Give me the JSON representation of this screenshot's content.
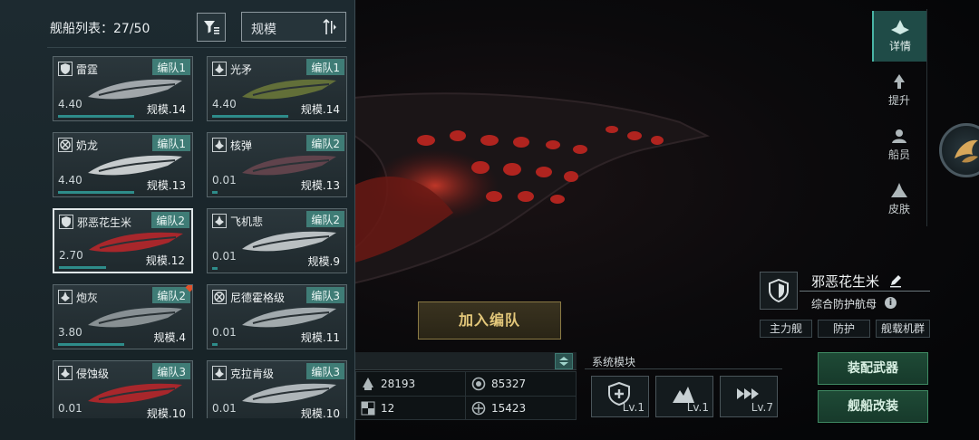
{
  "fleet_list": {
    "title": "舰船列表：",
    "count": "27/50",
    "sort_label": "规模",
    "ships": [
      {
        "name": "雷霆",
        "fleet": "编队1",
        "level": "4.40",
        "scale": "规模.14",
        "class_icon": "shield-icon"
      },
      {
        "name": "光矛",
        "fleet": "编队1",
        "level": "4.40",
        "scale": "规模.14",
        "class_icon": "attack-icon"
      },
      {
        "name": "奶龙",
        "fleet": "编队1",
        "level": "4.40",
        "scale": "规模.13",
        "class_icon": "support-icon"
      },
      {
        "name": "核弹",
        "fleet": "编队2",
        "level": "0.01",
        "scale": "规模.13",
        "class_icon": "attack-icon"
      },
      {
        "name": "邪恶花生米",
        "fleet": "编队2",
        "level": "2.70",
        "scale": "规模.12",
        "class_icon": "shield-icon"
      },
      {
        "name": "飞机悲",
        "fleet": "编队2",
        "level": "0.01",
        "scale": "规模.9",
        "class_icon": "attack-icon"
      },
      {
        "name": "炮灰",
        "fleet": "编队2",
        "level": "3.80",
        "scale": "规模.4",
        "class_icon": "attack-icon"
      },
      {
        "name": "尼德霍格级",
        "fleet": "编队3",
        "level": "0.01",
        "scale": "规模.11",
        "class_icon": "support-icon"
      },
      {
        "name": "侵蚀级",
        "fleet": "编队3",
        "level": "0.01",
        "scale": "规模.10",
        "class_icon": "attack-icon"
      },
      {
        "name": "克拉肯级",
        "fleet": "编队3",
        "level": "0.01",
        "scale": "规模.10",
        "class_icon": "attack-icon"
      }
    ]
  },
  "side_nav": {
    "items": [
      {
        "label": "详情",
        "icon": "detail-icon"
      },
      {
        "label": "提升",
        "icon": "upgrade-icon"
      },
      {
        "label": "船员",
        "icon": "crew-icon"
      },
      {
        "label": "皮肤",
        "icon": "skin-icon"
      }
    ]
  },
  "ship_info": {
    "name": "邪恶花生米",
    "type": "综合防护航母",
    "tags": [
      "主力舰",
      "防护",
      "舰载机群"
    ]
  },
  "join_button": "加入编队",
  "stats": {
    "values": [
      "28193",
      "85327",
      "12",
      "15423"
    ]
  },
  "modules": {
    "title": "系统模块",
    "items": [
      {
        "level": "Lv.1",
        "icon": "repair-module-icon"
      },
      {
        "level": "Lv.1",
        "icon": "mountain-module-icon"
      },
      {
        "level": "Lv.7",
        "icon": "thruster-module-icon"
      }
    ]
  },
  "actions": {
    "equip": "装配武器",
    "modify": "舰船改装"
  },
  "colors": {
    "accent_teal": "#3f7c76",
    "gold": "#e3c77a",
    "green_button": "#1e4a36",
    "ship_glow": "#d13a2a"
  }
}
